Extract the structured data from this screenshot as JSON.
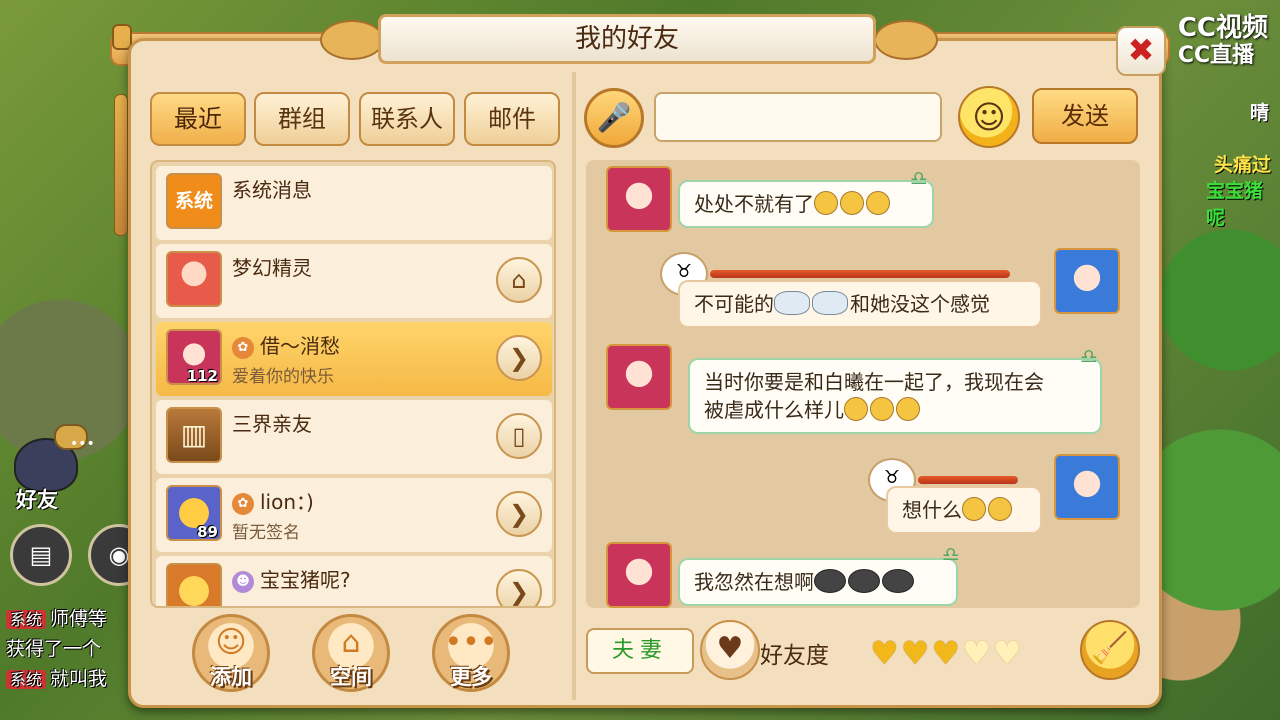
{
  "window": {
    "title": "我的好友",
    "close_symbol": "✖"
  },
  "overlay": {
    "logo_line1": "CC视频",
    "logo_line2": "CC直播"
  },
  "background_ui": {
    "friend_button_label": "好友",
    "friend_bubble": "•••",
    "chat_lines": [
      {
        "tag": "系统",
        "text": "师傅等"
      },
      {
        "tag": "",
        "text": "获得了一个 "
      },
      {
        "tag": "系统",
        "text": "就叫我"
      }
    ],
    "right_texts": [
      "晴",
      "头痛过",
      "宝宝猪呢"
    ]
  },
  "tabs": [
    {
      "label": "最近",
      "active": true
    },
    {
      "label": "群组",
      "active": false
    },
    {
      "label": "联系人",
      "active": false
    },
    {
      "label": "邮件",
      "active": false
    }
  ],
  "contacts": [
    {
      "name": "系统消息",
      "subtitle": "",
      "avatar_text": "系统",
      "level": "",
      "action_icon": ""
    },
    {
      "name": "梦幻精灵",
      "subtitle": "",
      "avatar_text": "",
      "level": "",
      "action_icon": "⌂"
    },
    {
      "name": "借～消愁",
      "subtitle": "爱着你的快乐",
      "avatar_text": "",
      "level": "112",
      "action_icon": "❯",
      "selected": true
    },
    {
      "name": "三界亲友",
      "subtitle": "",
      "avatar_text": "▥",
      "level": "",
      "action_icon": "▯"
    },
    {
      "name": "lion：)",
      "subtitle": "暂无签名",
      "avatar_text": "",
      "level": "89",
      "action_icon": "❯"
    },
    {
      "name": "宝宝猪呢?",
      "subtitle": "",
      "avatar_text": "",
      "level": "",
      "action_icon": "❯"
    }
  ],
  "bottom_actions": [
    {
      "label": "添加",
      "icon": "☺"
    },
    {
      "label": "空间",
      "icon": "⌂"
    },
    {
      "label": "更多",
      "icon": "•••"
    }
  ],
  "chat_bar": {
    "mic_icon": "🎤",
    "input_value": "",
    "input_placeholder": "",
    "emoji_icon": "☺",
    "send_label": "发送"
  },
  "messages": [
    {
      "side": "left",
      "text": "处处不就有了",
      "emoji_count": 3
    },
    {
      "side": "right",
      "text_before": "不可能的",
      "text_after": "和她没这个感觉",
      "emoji_count": 2
    },
    {
      "side": "left",
      "text_line1": "当时你要是和白曦在一起了，我现在会",
      "text_line2": "被虐成什么样儿",
      "emoji_count": 3
    },
    {
      "side": "right",
      "text": "想什么",
      "emoji_count": 2
    },
    {
      "side": "left",
      "text": "我忽然在想啊",
      "emoji_count": 3
    }
  ],
  "relationship": {
    "tag": "夫妻",
    "affinity_label": "好友度",
    "affinity_level": 3,
    "affinity_max": 5,
    "broom_icon": "🧹"
  },
  "colors": {
    "panel_bg": "#f3dfbd",
    "selected_row": "#f5b946",
    "bubble_border": "#9fd4a8",
    "accent_gold": "#f2b81a"
  }
}
